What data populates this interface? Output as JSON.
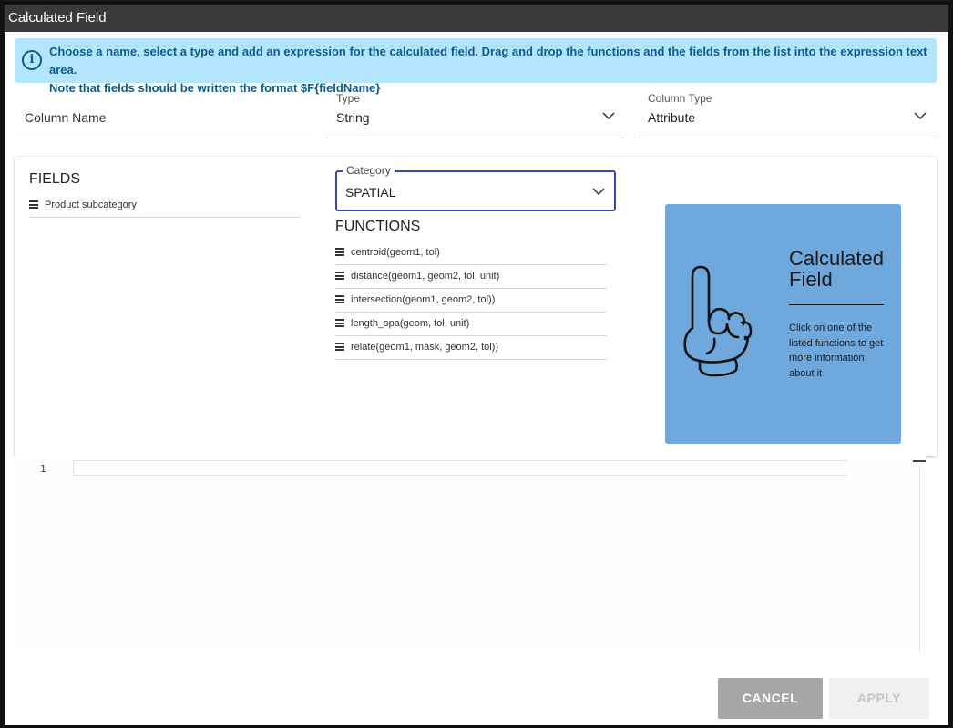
{
  "dialog": {
    "title": "Calculated Field"
  },
  "info": {
    "icon": "info-icon",
    "text_line1": "Choose a name, select a type and add an expression for the calculated field. Drag and drop the functions and the fields from the list into the expression text area.",
    "text_line2": "Note that fields should be written the format $F{fieldName}"
  },
  "form": {
    "column_name": {
      "placeholder": "Column Name"
    },
    "type": {
      "label": "Type",
      "value": "String"
    },
    "column_type": {
      "label": "Column Type",
      "value": "Attribute"
    }
  },
  "fields": {
    "title": "FIELDS",
    "items": [
      {
        "label": "Product subcategory"
      }
    ]
  },
  "category": {
    "label": "Category",
    "value": "SPATIAL"
  },
  "functions": {
    "title": "FUNCTIONS",
    "items": [
      {
        "label": "centroid(geom1, tol)"
      },
      {
        "label": "distance(geom1, geom2, tol, unit)"
      },
      {
        "label": "intersection(geom1, geom2, tol))"
      },
      {
        "label": "length_spa(geom, tol, unit)"
      },
      {
        "label": "relate(geom1, mask, geom2, tol))"
      }
    ]
  },
  "help_card": {
    "icon": "pointing-hand-icon",
    "title": "Calculated Field",
    "description": "Click on one of the listed functions to get more information about it",
    "background": "#6fa8dc"
  },
  "editor": {
    "line_number": "1",
    "value": ""
  },
  "actions": {
    "cancel_label": "CANCEL",
    "apply_label": "APPLY"
  },
  "colors": {
    "titlebar": "#3a3a3a",
    "info_background": "#b3e5fc",
    "info_text": "#0d5b8c",
    "category_border": "#3949ab",
    "cancel_button": "#a6a6a6",
    "apply_button_disabled": "#f0f0f0"
  }
}
